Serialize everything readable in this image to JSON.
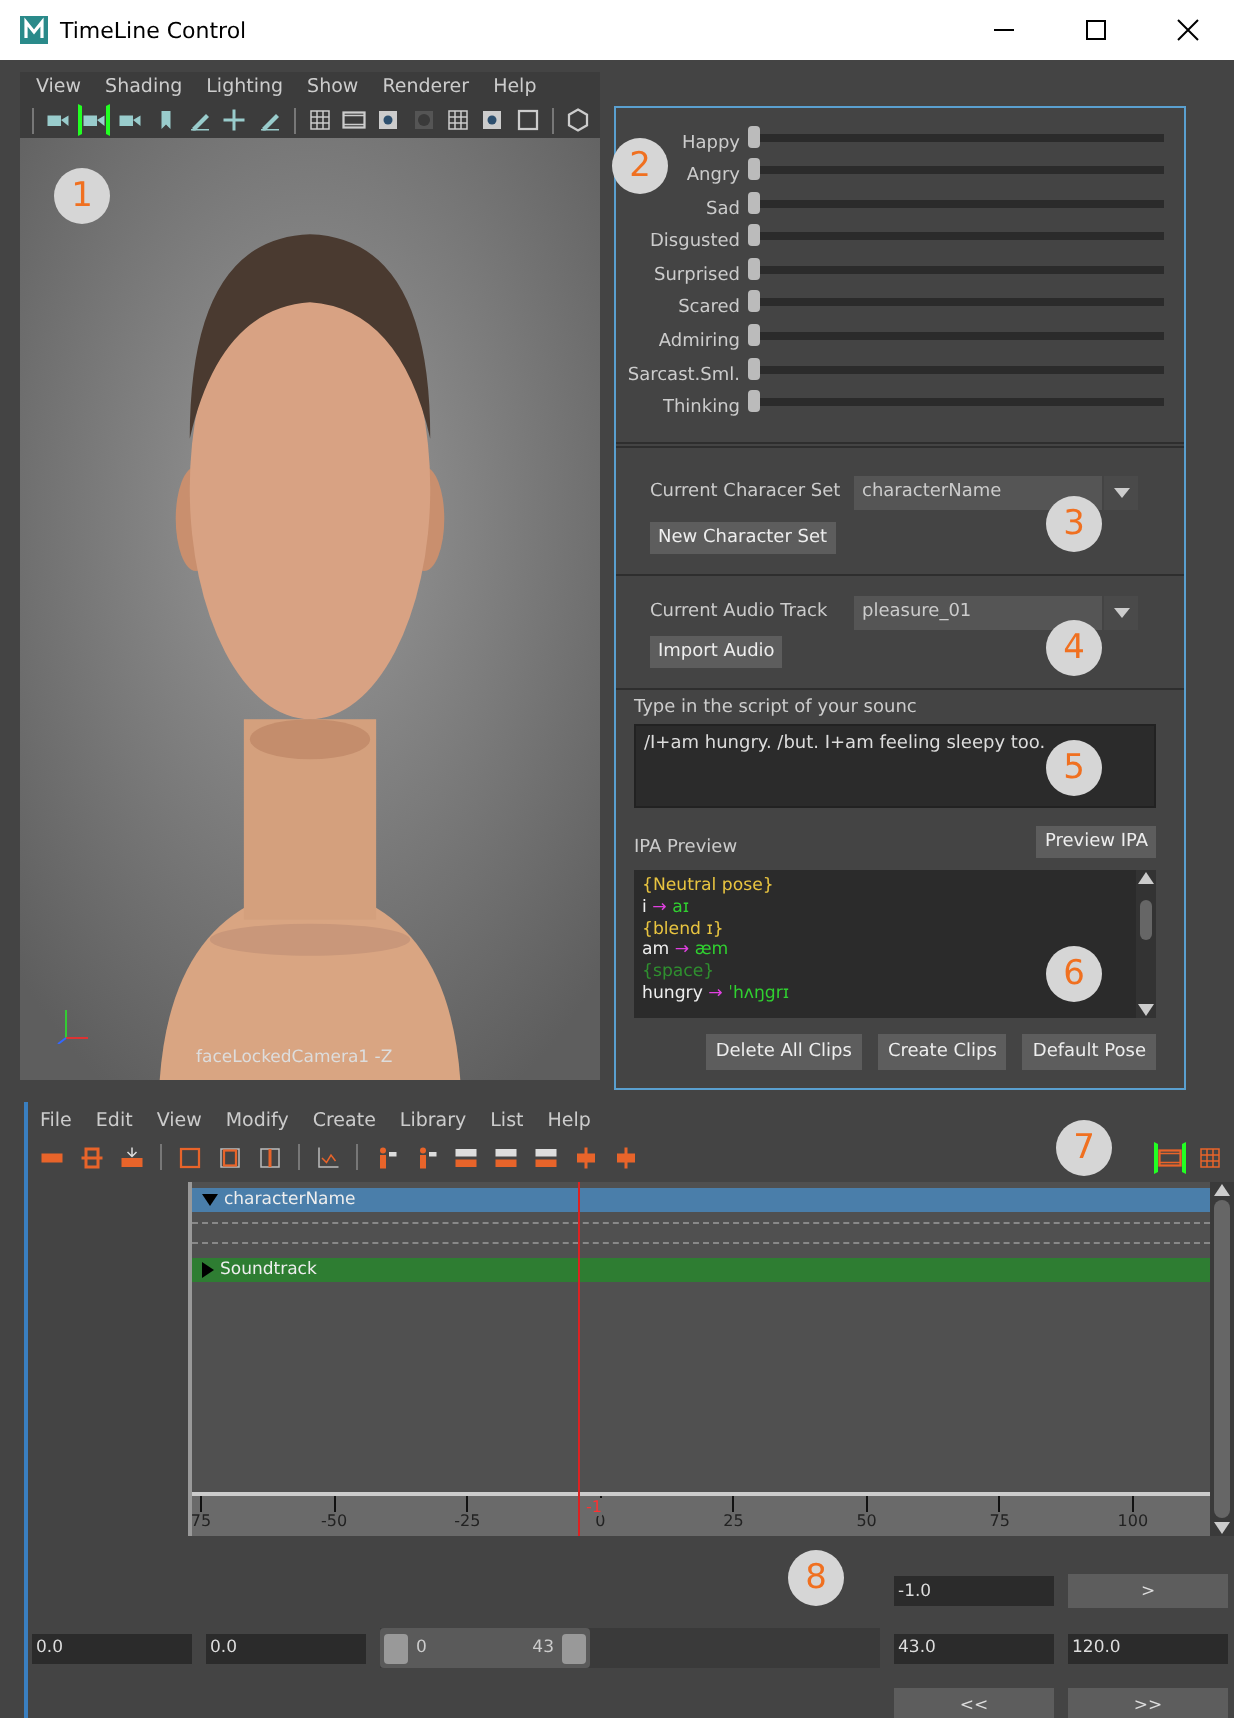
{
  "window": {
    "title": "TimeLine Control"
  },
  "viewport": {
    "menu": [
      "View",
      "Shading",
      "Lighting",
      "Show",
      "Renderer",
      "Help"
    ],
    "toolbar": [
      {
        "selected": false
      },
      {
        "selected": true
      },
      {
        "selected": false
      },
      {
        "selected": false
      },
      {
        "selected": false
      },
      {
        "selected": false
      },
      {
        "selected": false
      },
      {
        "selected": false
      },
      {
        "selected": false
      },
      {
        "selected": false
      },
      {
        "selected": false
      },
      {
        "selected": false
      },
      {
        "selected": false
      },
      {
        "selected": false
      },
      {
        "selected": false
      }
    ],
    "camera_label": "faceLockedCamera1 -Z"
  },
  "emotions": [
    {
      "label": "Happy",
      "level": 0
    },
    {
      "label": "Angry",
      "level": 0
    },
    {
      "label": "Sad",
      "level": 0
    },
    {
      "label": "Disgusted",
      "level": 0
    },
    {
      "label": "Surprised",
      "level": 0
    },
    {
      "label": "Scared",
      "level": 0
    },
    {
      "label": "Admiring",
      "level": 0
    },
    {
      "label": "Sarcast.Sml.",
      "level": 0
    },
    {
      "label": "Thinking",
      "level": 0
    }
  ],
  "character_set": {
    "label": "Current Characer Set",
    "value": "characterName",
    "button": "New Character Set"
  },
  "audio_track": {
    "label": "Current Audio Track",
    "value": "pleasure_01",
    "button": "Import Audio"
  },
  "script": {
    "label": "Type in the script of your sounc",
    "value": "/I+am hungry. /but. I+am feeling sleepy too."
  },
  "ipa_preview": {
    "label": "IPA Preview",
    "button": "Preview IPA",
    "lines": [
      {
        "kind": "tag",
        "text": "{Neutral pose}",
        "color": "#e8c440"
      },
      {
        "kind": "map",
        "word": "i",
        "arrow": "→",
        "ipa": "aɪ"
      },
      {
        "kind": "tag",
        "text": "{blend ɪ}",
        "color": "#e8c440"
      },
      {
        "kind": "map",
        "word": "am",
        "arrow": "→",
        "ipa": "æm"
      },
      {
        "kind": "tag",
        "text": "{space}",
        "color": "#2f8f2f"
      },
      {
        "kind": "map",
        "word": "hungry",
        "arrow": "→",
        "ipa": "ˈhʌŋgrɪ"
      }
    ]
  },
  "actions": [
    "Delete All Clips",
    "Create Clips",
    "Default Pose"
  ],
  "timeline": {
    "menu": [
      "File",
      "Edit",
      "View",
      "Modify",
      "Create",
      "Library",
      "List",
      "Help"
    ],
    "toolbar": [
      {
        "selected": false
      },
      {
        "selected": false
      },
      {
        "selected": false
      },
      {
        "selected": false
      },
      {
        "selected": false
      },
      {
        "selected": false
      },
      {
        "selected": false
      },
      {
        "selected": false
      },
      {
        "selected": false
      },
      {
        "selected": false
      },
      {
        "selected": false
      },
      {
        "selected": false
      },
      {
        "selected": false
      },
      {
        "selected": false
      }
    ],
    "view_buttons": [
      {
        "selected": true
      },
      {
        "selected": false
      }
    ],
    "tracks": [
      {
        "kind": "character",
        "label": "characterName",
        "expanded": true
      },
      {
        "kind": "audio",
        "label": "Soundtrack",
        "expanded": false
      }
    ],
    "ruler": {
      "ticks": [
        "75",
        "-50",
        "-25",
        "0",
        "25",
        "50",
        "75",
        "100"
      ],
      "current_frame": "-1"
    }
  },
  "range": {
    "current_field": "-1.0",
    "step_forward": ">",
    "start_field": "0.0",
    "min_field": "0.0",
    "slider_start": "0",
    "slider_end": "43",
    "level": 0.42,
    "end_field": "43.0",
    "max_field": "120.0",
    "back_button": "<<",
    "forward_button": ">>"
  },
  "markers": [
    "1",
    "2",
    "3",
    "4",
    "5",
    "6",
    "7",
    "8"
  ]
}
